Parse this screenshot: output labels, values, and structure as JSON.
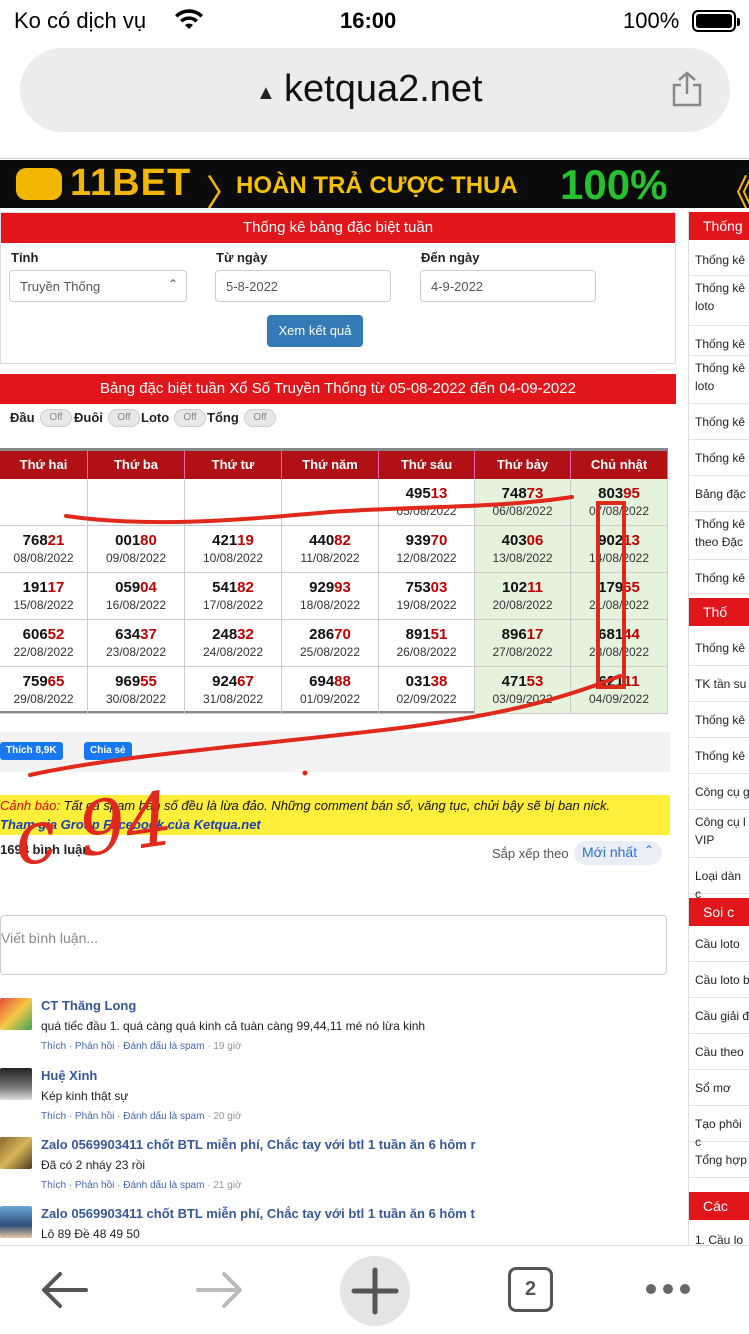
{
  "status_bar": {
    "carrier": "Ko có dịch vụ",
    "time": "16:00",
    "battery": "100%"
  },
  "browser": {
    "url": "ketqua2.net",
    "tab_count": "2"
  },
  "banner": {
    "brand": "11BET",
    "text": "HOÀN TRẢ CƯỢC THUA",
    "percent": "100%"
  },
  "form": {
    "title": "Thống kê bảng đặc biệt tuần",
    "province_label": "Tỉnh",
    "province_value": "Truyền Thống",
    "from_label": "Từ ngày",
    "from_value": "5-8-2022",
    "to_label": "Đến ngày",
    "to_value": "4-9-2022",
    "submit": "Xem kết quả"
  },
  "results": {
    "title": "Bảng đặc biệt tuần Xổ Số Truyền Thống từ 05-08-2022 đến 04-09-2022",
    "toggles": [
      {
        "label": "Đầu",
        "state": "Off"
      },
      {
        "label": "Đuôi",
        "state": "Off"
      },
      {
        "label": "Loto",
        "state": "Off"
      },
      {
        "label": "Tổng",
        "state": "Off"
      }
    ],
    "days": [
      "Thứ hai",
      "Thứ ba",
      "Thứ tư",
      "Thứ năm",
      "Thứ sáu",
      "Thứ bảy",
      "Chủ nhật"
    ],
    "rows": [
      [
        {
          "head": "",
          "tail": "",
          "date": ""
        },
        {
          "head": "",
          "tail": "",
          "date": ""
        },
        {
          "head": "",
          "tail": "",
          "date": ""
        },
        {
          "head": "",
          "tail": "",
          "date": ""
        },
        {
          "head": "495",
          "tail": "13",
          "date": "05/08/2022"
        },
        {
          "head": "748",
          "tail": "73",
          "date": "06/08/2022"
        },
        {
          "head": "803",
          "tail": "95",
          "date": "07/08/2022"
        }
      ],
      [
        {
          "head": "768",
          "tail": "21",
          "date": "08/08/2022"
        },
        {
          "head": "001",
          "tail": "80",
          "date": "09/08/2022"
        },
        {
          "head": "421",
          "tail": "19",
          "date": "10/08/2022"
        },
        {
          "head": "440",
          "tail": "82",
          "date": "11/08/2022"
        },
        {
          "head": "939",
          "tail": "70",
          "date": "12/08/2022"
        },
        {
          "head": "403",
          "tail": "06",
          "date": "13/08/2022"
        },
        {
          "head": "902",
          "tail": "13",
          "date": "14/08/2022"
        }
      ],
      [
        {
          "head": "191",
          "tail": "17",
          "date": "15/08/2022"
        },
        {
          "head": "059",
          "tail": "04",
          "date": "16/08/2022"
        },
        {
          "head": "541",
          "tail": "82",
          "date": "17/08/2022"
        },
        {
          "head": "929",
          "tail": "93",
          "date": "18/08/2022"
        },
        {
          "head": "753",
          "tail": "03",
          "date": "19/08/2022"
        },
        {
          "head": "102",
          "tail": "11",
          "date": "20/08/2022"
        },
        {
          "head": "179",
          "tail": "65",
          "date": "21/08/2022"
        }
      ],
      [
        {
          "head": "606",
          "tail": "52",
          "date": "22/08/2022"
        },
        {
          "head": "634",
          "tail": "37",
          "date": "23/08/2022"
        },
        {
          "head": "248",
          "tail": "32",
          "date": "24/08/2022"
        },
        {
          "head": "286",
          "tail": "70",
          "date": "25/08/2022"
        },
        {
          "head": "891",
          "tail": "51",
          "date": "26/08/2022"
        },
        {
          "head": "896",
          "tail": "17",
          "date": "27/08/2022"
        },
        {
          "head": "681",
          "tail": "44",
          "date": "28/08/2022"
        }
      ],
      [
        {
          "head": "759",
          "tail": "65",
          "date": "29/08/2022"
        },
        {
          "head": "969",
          "tail": "55",
          "date": "30/08/2022"
        },
        {
          "head": "924",
          "tail": "67",
          "date": "31/08/2022"
        },
        {
          "head": "694",
          "tail": "88",
          "date": "01/09/2022"
        },
        {
          "head": "031",
          "tail": "38",
          "date": "02/09/2022"
        },
        {
          "head": "471",
          "tail": "53",
          "date": "03/09/2022"
        },
        {
          "head": "621",
          "tail": "11",
          "date": "04/09/2022"
        }
      ]
    ]
  },
  "social": {
    "like": "Thích 8,9K",
    "share": "Chia sẻ"
  },
  "warning": {
    "prefix": "Cảnh báo:",
    "text": " Tất cả spam bán số đều là lừa đảo. Những comment bán số, văng tục, chửi bậy sẽ bị ban nick.",
    "link": "Tham gia Group Facebook của Ketqua.net"
  },
  "comments_section": {
    "count": "1694 bình luận",
    "sort_label": "Sắp xếp theo",
    "sort_value": "Mới nhất",
    "placeholder": "Viết bình luận...",
    "items": [
      {
        "name": "CT Thăng Long",
        "text": "quá tiếc đầu 1. quá càng quá kinh cả tuàn càng 99,44,11 mé nó lừa kinh",
        "actions": "Thích · Phản hồi · Đánh dấu là spam",
        "age": "19 giờ"
      },
      {
        "name": "Huệ Xinh",
        "text": "Kép kinh thật sự",
        "actions": "Thích · Phản hồi · Đánh dấu là spam",
        "age": "20 giờ"
      },
      {
        "name": "Zalo 0569903411 chốt BTL miễn phí, Chắc tay với btl 1 tuần ăn 6 hôm r",
        "text": "Đã có 2 nháy 23 rồi",
        "actions": "Thích · Phản hồi · Đánh dấu là spam",
        "age": "21 giờ"
      },
      {
        "name": "Zalo 0569903411 chốt BTL miễn phí, Chắc tay với btl 1 tuần ăn 6 hôm t",
        "text": "Lô 89 Đề 48 49 50",
        "actions": "",
        "age": ""
      }
    ]
  },
  "sidebar": {
    "section1_title": "Thống",
    "section1_items": [
      "Thống kê",
      "Thống kê loto",
      "Thống kê",
      "Thống kê loto",
      "Thống kê",
      "Thống kê",
      "Bảng đặc",
      "Thống kê theo Đặc",
      "Thống kê"
    ],
    "section2_title": "Thố",
    "section2_items": [
      "Thống kê",
      "TK tần su",
      "Thống kê",
      "Thống kê",
      "Công cụ g",
      "Công cụ l VIP",
      "Loại dàn c"
    ],
    "section3_title": "Soi c",
    "section3_items": [
      "Cầu loto",
      "Cầu loto b",
      "Cầu giải đ",
      "Cầu theo",
      "Sổ mơ",
      "Tạo phôi c",
      "Tổng hợp"
    ],
    "section4_title": "Các",
    "section4_items": [
      "1.  Cầu lo"
    ]
  },
  "annotation": {
    "text": "c 94"
  }
}
